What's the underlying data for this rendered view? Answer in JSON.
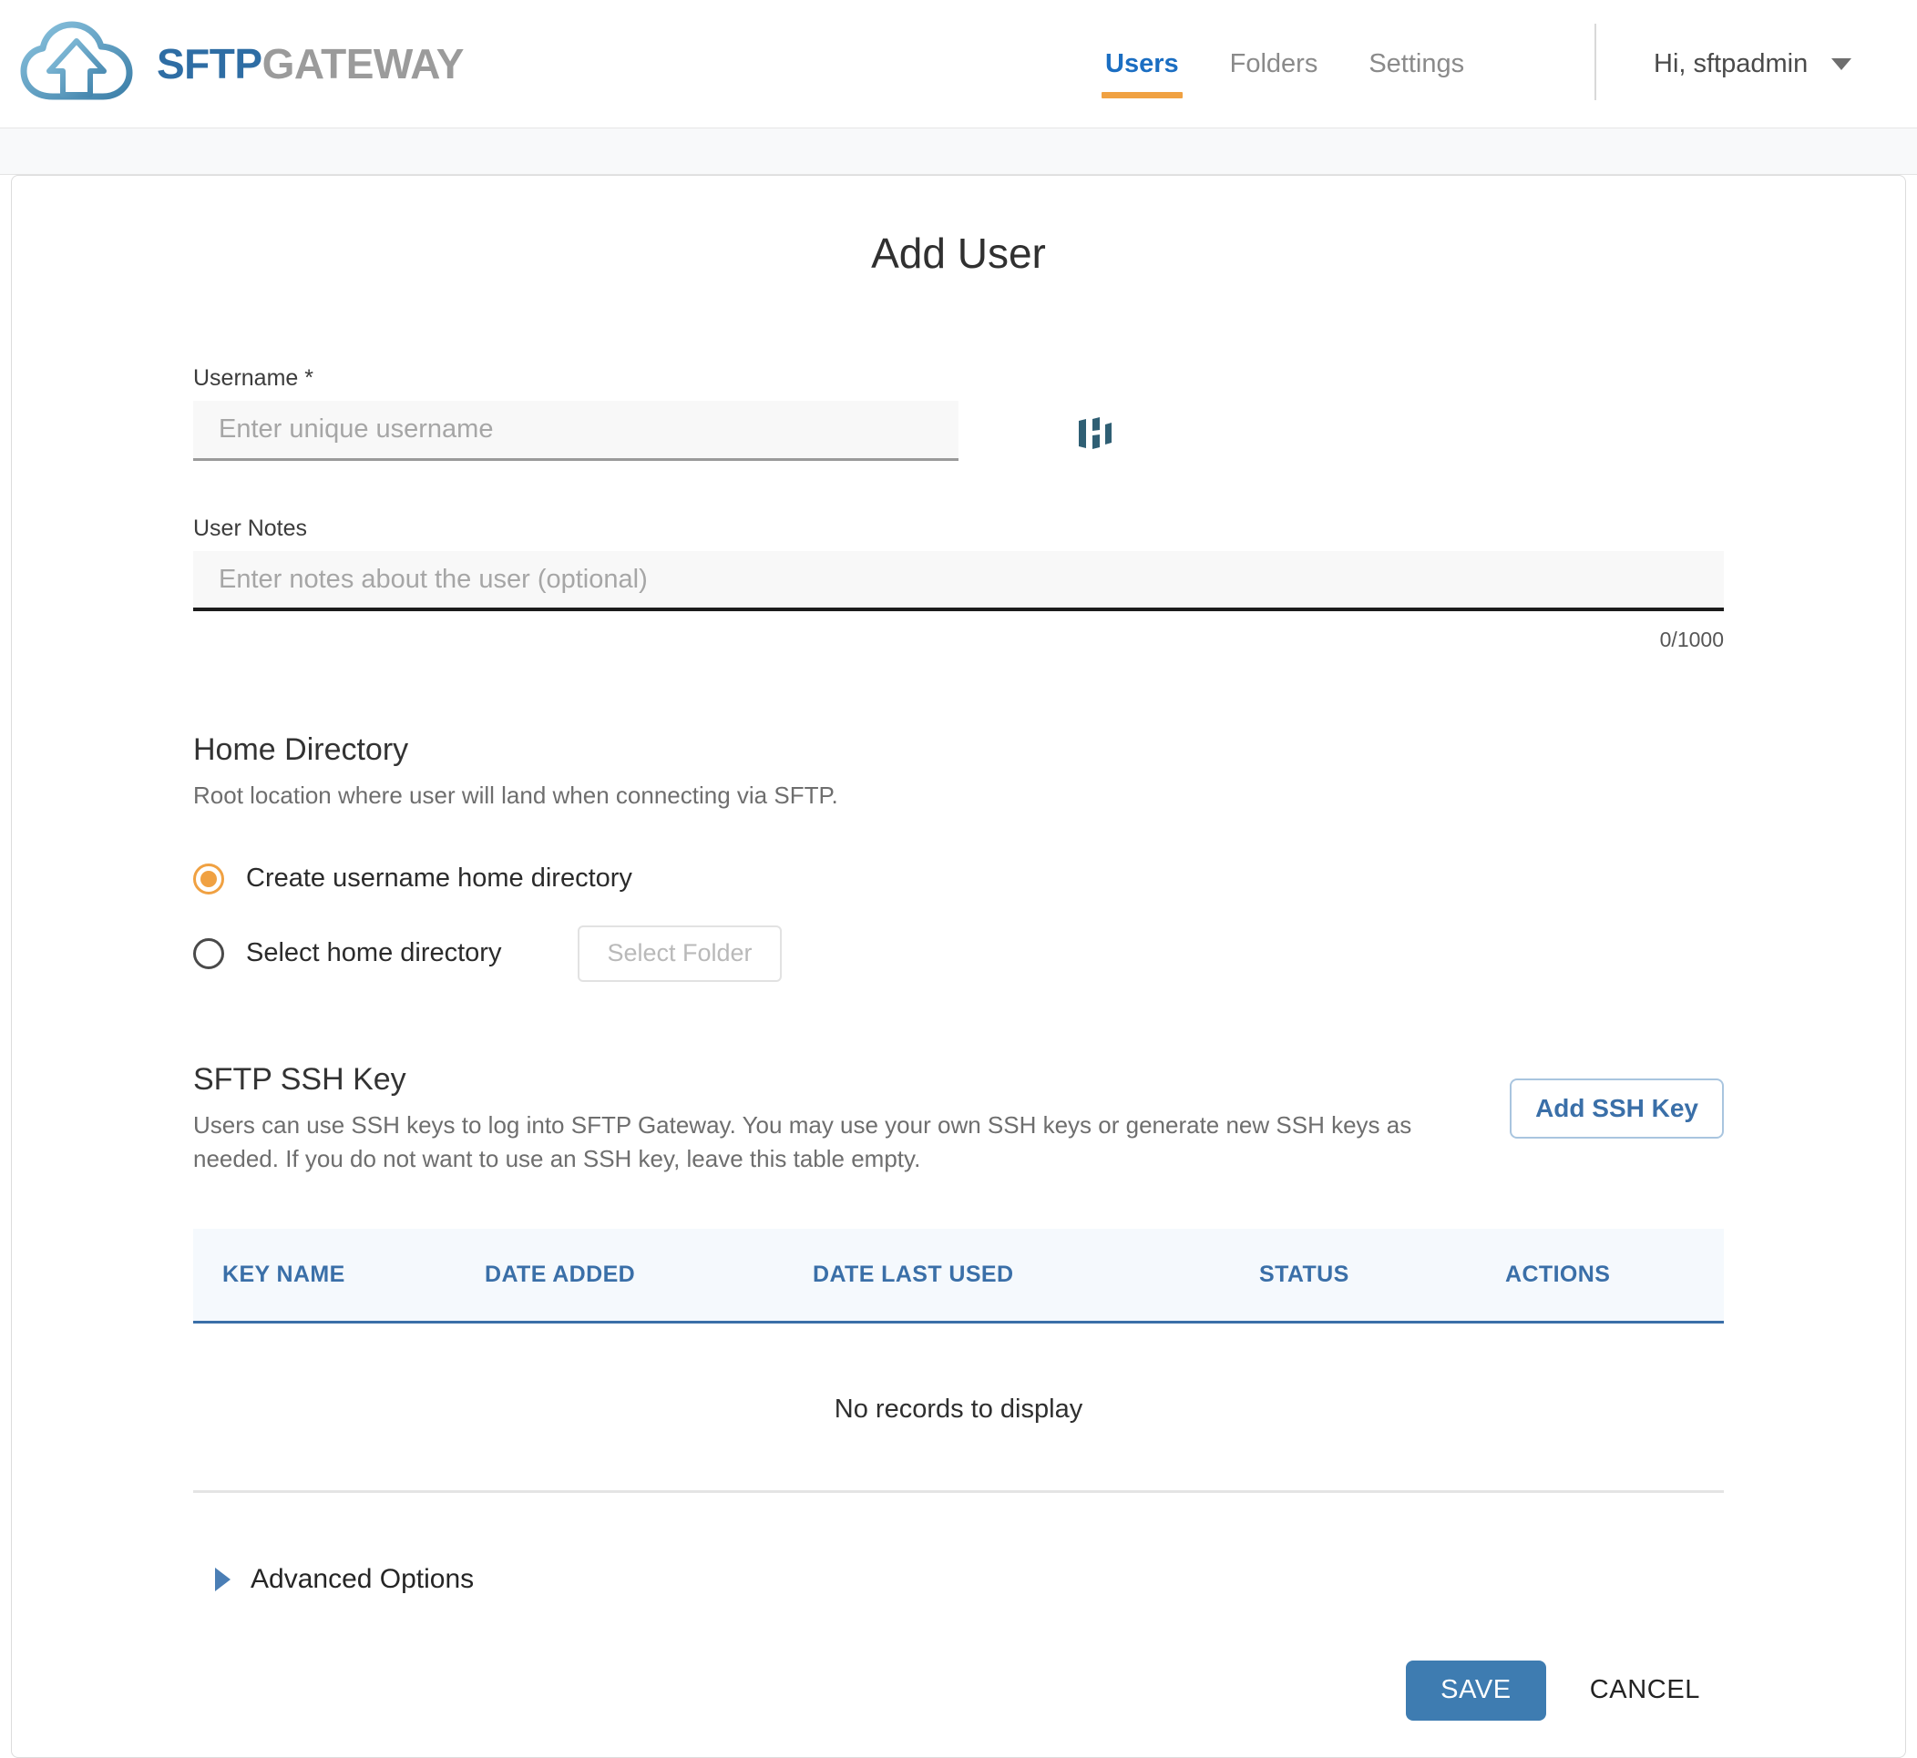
{
  "brand": {
    "name_part1": "SFTP",
    "name_part2": "GATEWAY",
    "logo_icon": "cloud-upload-icon"
  },
  "nav": {
    "items": [
      {
        "label": "Users",
        "active": true
      },
      {
        "label": "Folders",
        "active": false
      },
      {
        "label": "Settings",
        "active": false
      }
    ],
    "user_menu": {
      "label": "Hi, sftpadmin",
      "caret_icon": "chevron-down-icon"
    },
    "active_underline_color": "#F0A142"
  },
  "page": {
    "title": "Add User"
  },
  "form": {
    "username": {
      "label": "Username *",
      "value": "",
      "placeholder": "Enter unique username",
      "addon_icon": "password-manager-icon"
    },
    "notes": {
      "label": "User Notes",
      "value": "",
      "placeholder": "Enter notes about the user (optional)",
      "counter": "0/1000"
    }
  },
  "home_directory": {
    "title": "Home Directory",
    "description": "Root location where user will land when connecting via SFTP.",
    "options": [
      {
        "label": "Create username home directory",
        "selected": true
      },
      {
        "label": "Select home directory",
        "selected": false
      }
    ],
    "select_folder_button": "Select Folder"
  },
  "ssh_key": {
    "title": "SFTP SSH Key",
    "description": "Users can use SSH keys to log into SFTP Gateway. You may use your own SSH keys or generate new SSH keys as needed. If you do not want to use an SSH key, leave this table empty.",
    "add_button": "Add SSH Key",
    "table": {
      "columns": [
        "KEY NAME",
        "DATE ADDED",
        "DATE LAST USED",
        "STATUS",
        "ACTIONS"
      ],
      "rows": [],
      "empty_message": "No records to display"
    }
  },
  "advanced_options": {
    "label": "Advanced Options",
    "expanded": false,
    "toggle_icon": "triangle-right-icon"
  },
  "footer": {
    "save_label": "SAVE",
    "cancel_label": "CANCEL"
  },
  "colors": {
    "brand_blue": "#2E6DA4",
    "brand_gray": "#9B9B9B",
    "accent_orange": "#F0A142",
    "link_blue": "#1B6EC2",
    "primary_button": "#3E7CB1",
    "table_header_blue": "#3A6FA8"
  }
}
